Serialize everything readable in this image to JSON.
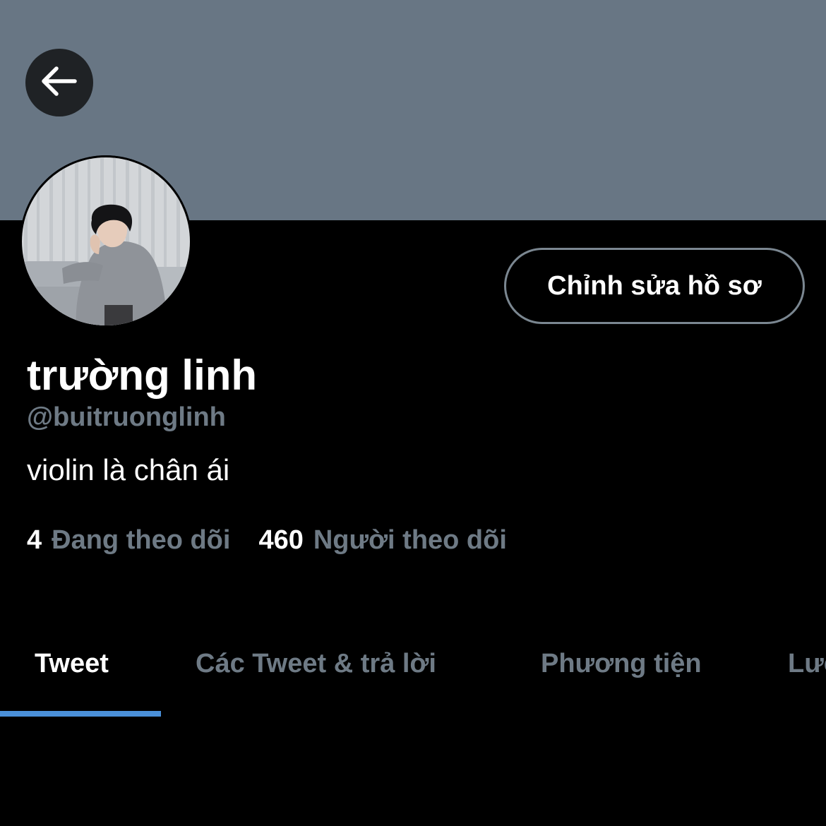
{
  "profile": {
    "display_name": "trường linh",
    "handle": "@buitruonglinh",
    "bio": "violin là chân ái",
    "edit_button_label": "Chỉnh sửa hồ sơ",
    "banner_color": "#687684",
    "avatar_icon": "profile-photo"
  },
  "navigation": {
    "back_icon": "arrow-left-icon"
  },
  "stats": {
    "following_count": "4",
    "following_label": "Đang theo dõi",
    "followers_count": "460",
    "followers_label": "Người theo dõi"
  },
  "tabs": [
    {
      "label": "Tweet",
      "active": true
    },
    {
      "label": "Các Tweet & trả lời",
      "active": false
    },
    {
      "label": "Phương tiện",
      "active": false
    },
    {
      "label": "Lượt thích",
      "active": false
    }
  ],
  "colors": {
    "background": "#000000",
    "text_primary": "#ffffff",
    "text_secondary": "#6e7a85",
    "accent": "#4a90d9"
  }
}
